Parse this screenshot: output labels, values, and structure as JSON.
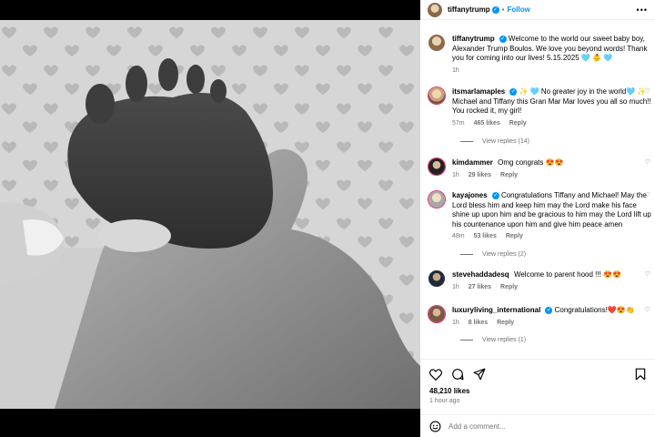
{
  "post": {
    "author": "tiffanytrump",
    "follow_label": "Follow",
    "separator": "•",
    "more_label": "•••",
    "caption_user": "tiffanytrump",
    "caption_text": "Welcome to the world our sweet baby boy, Alexander Trump Boulos. We love you beyond words! Thank you for coming into our lives! 5.15.2025 🩵 👶 🩵",
    "caption_time": "1h"
  },
  "comments": [
    {
      "user": "itsmarlamaples",
      "verified": true,
      "text": "✨ 🩵 No greater joy in the world🩵 ✨ Michael and Tiffany this Gran Mar Mar loves you all so much!! You rocked it, my girl!",
      "time": "57m",
      "likes": "465 likes",
      "reply": "Reply",
      "replies": "View replies (14)"
    },
    {
      "user": "kimdammer",
      "verified": false,
      "text": "Omg congrats 😍😍",
      "time": "1h",
      "likes": "29 likes",
      "reply": "Reply"
    },
    {
      "user": "kayajones",
      "verified": true,
      "text": "Congratulations Tiffany and Michael! May the Lord bless him and keep him may the Lord make his face shine up upon him and be gracious to him may the Lord lift up his countenance upon him and give him peace amen",
      "time": "48m",
      "likes": "53 likes",
      "reply": "Reply",
      "replies": "View replies (2)"
    },
    {
      "user": "stevehaddadesq",
      "verified": false,
      "text": "Welcome to parent hood !!! 😍😍",
      "time": "1h",
      "likes": "27 likes",
      "reply": "Reply"
    },
    {
      "user": "luxuryliving_international",
      "verified": true,
      "text": "Congratulations!❤️😍👏",
      "time": "1h",
      "likes": "8 likes",
      "reply": "Reply",
      "replies": "View replies (1)"
    }
  ],
  "actions": {
    "likes": "48,210 likes",
    "time_ago": "1 hour ago",
    "add_comment_placeholder": "Add a comment..."
  },
  "icons": {
    "verified": "verified-badge-icon",
    "heart": "heart-icon",
    "comment": "comment-icon",
    "share": "share-icon",
    "bookmark": "bookmark-icon",
    "emoji": "emoji-icon"
  },
  "colors": {
    "accent": "#0095f6",
    "muted": "#737373",
    "heart": "#ed4956"
  }
}
